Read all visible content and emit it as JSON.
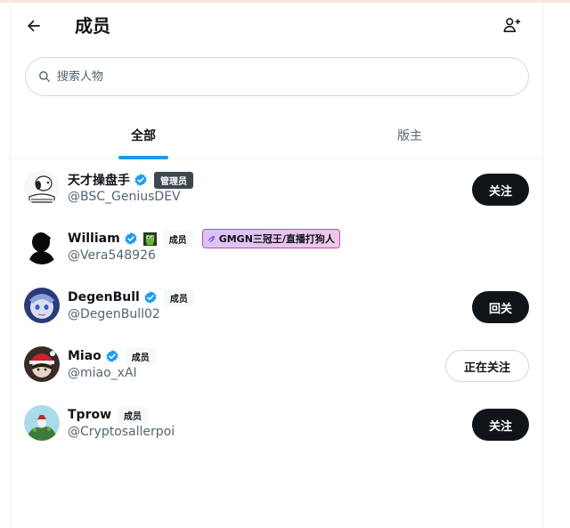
{
  "header": {
    "title": "成员",
    "back_icon": "arrow-left-icon",
    "add_icon": "person-add-icon"
  },
  "search": {
    "placeholder": "搜索人物",
    "value": ""
  },
  "tabs": [
    {
      "label": "全部",
      "active": true
    },
    {
      "label": "版主",
      "active": false
    }
  ],
  "colors": {
    "accent": "#1d9bf0",
    "text": "#0f1419",
    "muted": "#536471",
    "border": "#cfd9de"
  },
  "members": [
    {
      "name": "天才操盘手",
      "handle": "@BSC_GeniusDEV",
      "verified": true,
      "role": "管理员",
      "button": "关注"
    },
    {
      "name": "William",
      "handle": "@Vera548926",
      "verified": true,
      "role": "成员",
      "tag": "GMGN三冠王/直播打狗人",
      "button": ""
    },
    {
      "name": "DegenBull",
      "handle": "@DegenBull02",
      "verified": true,
      "role": "成员",
      "button": "回关"
    },
    {
      "name": "Miao",
      "handle": "@miao_xAI",
      "verified": true,
      "role": "成员",
      "button": "正在关注"
    },
    {
      "name": "Tprow",
      "handle": "@Cryptosallerpoi",
      "verified": false,
      "role": "成员",
      "button": "关注"
    }
  ]
}
